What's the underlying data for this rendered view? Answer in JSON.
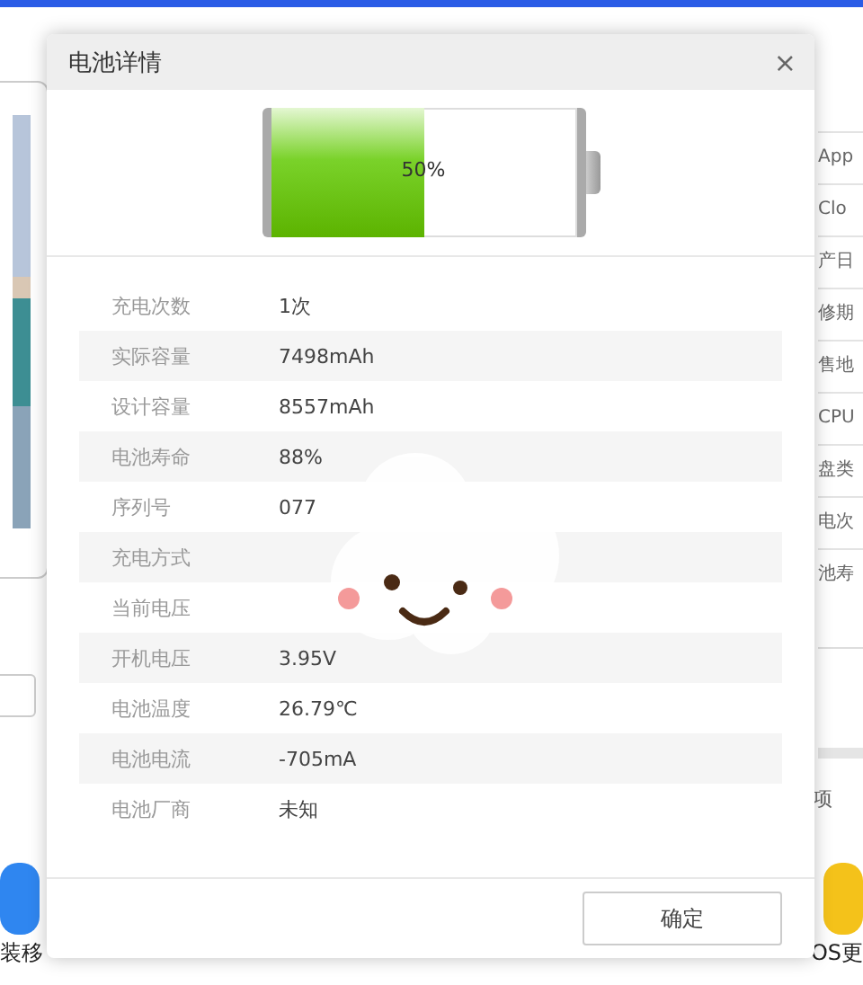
{
  "background": {
    "side_items": [
      "App",
      "Clo",
      "产日",
      "修期",
      "售地",
      "CPU",
      "盘类",
      "电次",
      "池寿"
    ],
    "side_note": "项",
    "apps": [
      {
        "label": "装移",
        "kind": "transfer"
      },
      {
        "label": "OS更",
        "kind": "update"
      }
    ]
  },
  "dialog": {
    "title": "电池详情",
    "close": "×",
    "battery": {
      "level": 0.5,
      "reading": "50%"
    },
    "rows": [
      {
        "label": "充电次数",
        "value": "1次"
      },
      {
        "label": "实际容量",
        "value": "7498mAh"
      },
      {
        "label": "设计容量",
        "value": "8557mAh"
      },
      {
        "label": "电池寿命",
        "value": "88%"
      },
      {
        "label": "序列号",
        "value": "077"
      },
      {
        "label": "充电方式"
      },
      {
        "label": "当前电压"
      },
      {
        "label": "开机电压",
        "value": "3.95V"
      },
      {
        "label": "电池温度",
        "value": "26.79℃"
      },
      {
        "label": "电池电流",
        "value": "-705mA"
      },
      {
        "label": "电池厂商",
        "value": "未知"
      }
    ],
    "button": "确定"
  }
}
